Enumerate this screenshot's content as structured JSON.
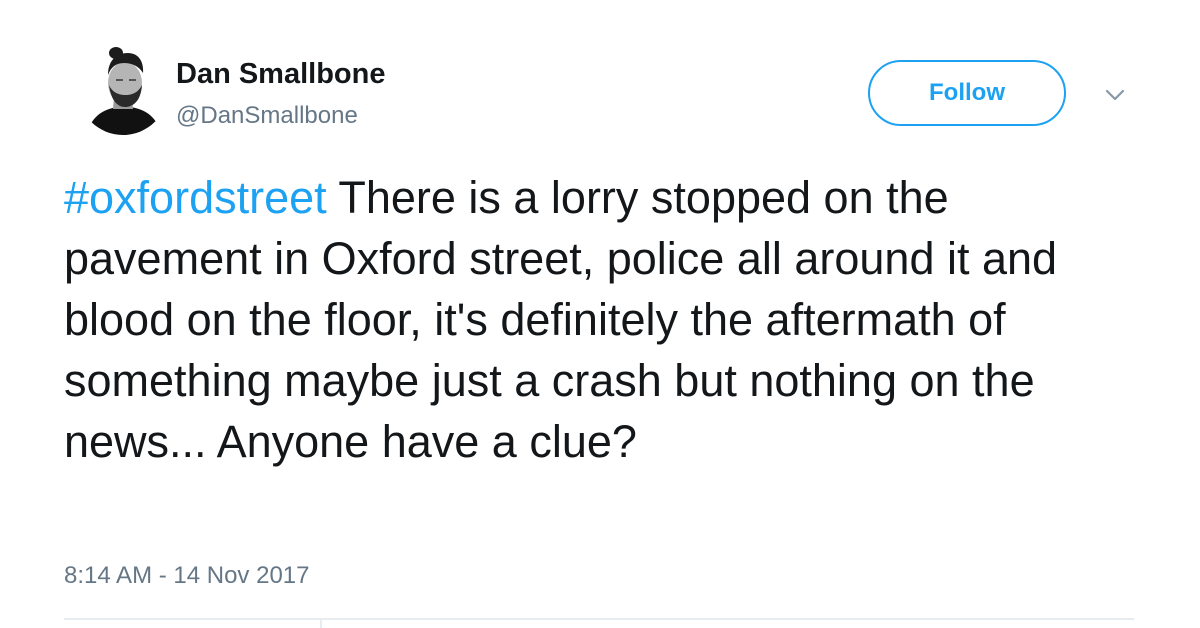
{
  "user": {
    "display_name": "Dan Smallbone",
    "handle": "@DanSmallbone",
    "avatar_icon": "profile-photo"
  },
  "actions": {
    "follow_label": "Follow",
    "menu_icon": "chevron-down-icon"
  },
  "tweet": {
    "hashtag": "#oxfordstreet",
    "body": " There is a lorry stopped on the pavement in Oxford street, police all around it and blood on the floor, it's definitely the aftermath of something maybe just a crash but nothing on the news... Anyone have a clue?",
    "timestamp": "8:14 AM - 14 Nov 2017"
  },
  "colors": {
    "accent": "#1da1f2",
    "text": "#14171a",
    "secondary_text": "#657786",
    "divider": "#e6ecf0"
  }
}
